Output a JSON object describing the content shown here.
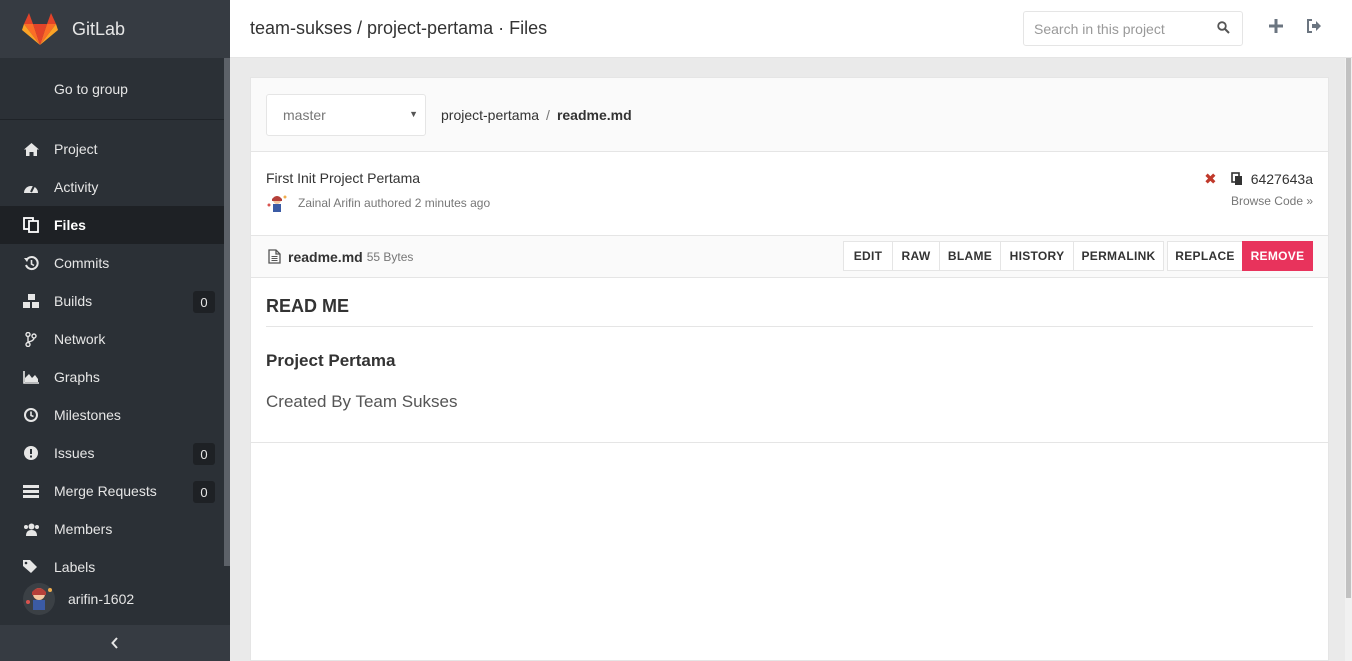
{
  "brand": {
    "name": "GitLab"
  },
  "sidebar": {
    "go_to_group": "Go to group",
    "items": [
      {
        "label": "Project",
        "icon": "home-icon"
      },
      {
        "label": "Activity",
        "icon": "dashboard-icon"
      },
      {
        "label": "Files",
        "icon": "files-icon",
        "active": true
      },
      {
        "label": "Commits",
        "icon": "history-icon"
      },
      {
        "label": "Builds",
        "icon": "cubes-icon",
        "badge": "0"
      },
      {
        "label": "Network",
        "icon": "code-fork-icon"
      },
      {
        "label": "Graphs",
        "icon": "area-chart-icon"
      },
      {
        "label": "Milestones",
        "icon": "clock-icon"
      },
      {
        "label": "Issues",
        "icon": "exclamation-circle-icon",
        "badge": "0"
      },
      {
        "label": "Merge Requests",
        "icon": "list-icon",
        "badge": "0"
      },
      {
        "label": "Members",
        "icon": "users-icon"
      },
      {
        "label": "Labels",
        "icon": "tags-icon"
      }
    ],
    "user": "arifin-1602",
    "collapse_icon": "chevron-left-icon"
  },
  "header": {
    "title": "team-sukses / project-pertama · Files",
    "search_placeholder": "Search in this project"
  },
  "tree": {
    "branch": "master",
    "project": "project-pertama",
    "separator": "/",
    "file": "readme.md"
  },
  "commit": {
    "message": "First Init Project Pertama",
    "author": "Zainal Arifin",
    "authored_text": "authored 2 minutes ago",
    "sha": "6427643a",
    "browse_code": "Browse Code »"
  },
  "file": {
    "name": "readme.md",
    "size": "55 Bytes",
    "buttons": {
      "edit": "EDIT",
      "raw": "RAW",
      "blame": "BLAME",
      "history": "HISTORY",
      "permalink": "PERMALINK",
      "replace": "REPLACE",
      "remove": "REMOVE"
    }
  },
  "readme": {
    "h1": "READ ME",
    "h2": "Project Pertama",
    "p": "Created By Team Sukses"
  },
  "colors": {
    "sidebar_bg": "#2b3036",
    "danger": "#e8335c",
    "brand_orange": "#e24329"
  }
}
